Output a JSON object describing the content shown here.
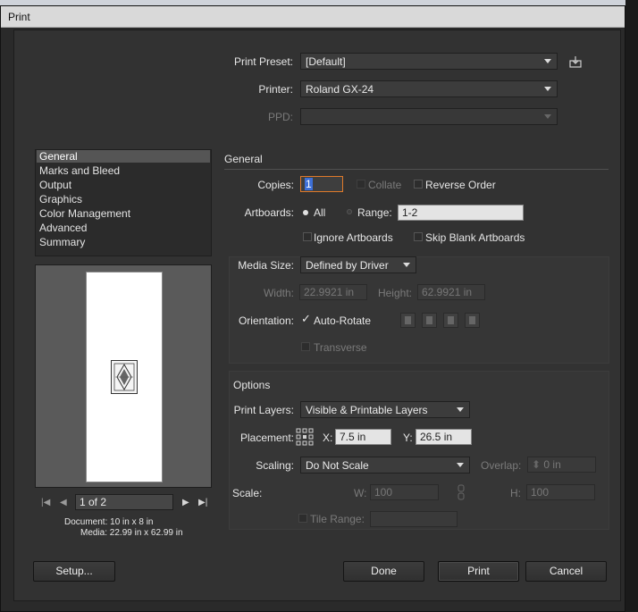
{
  "window": {
    "title": "Print"
  },
  "top": {
    "print_preset_label": "Print Preset:",
    "print_preset_value": "[Default]",
    "printer_label": "Printer:",
    "printer_value": "Roland GX-24",
    "ppd_label": "PPD:",
    "ppd_value": ""
  },
  "sidebar": {
    "items": [
      {
        "label": "General",
        "selected": true
      },
      {
        "label": "Marks and Bleed"
      },
      {
        "label": "Output"
      },
      {
        "label": "Graphics"
      },
      {
        "label": "Color Management"
      },
      {
        "label": "Advanced"
      },
      {
        "label": "Summary"
      }
    ],
    "page_indicator": "1 of 2",
    "document_info": "Document: 10 in x 8 in",
    "media_info": "Media: 22.99 in x 62.99 in"
  },
  "general": {
    "heading": "General",
    "copies_label": "Copies:",
    "copies_value": "1",
    "collate_label": "Collate",
    "reverse_order_label": "Reverse Order",
    "artboards_label": "Artboards:",
    "all_label": "All",
    "range_label": "Range:",
    "range_value": "1-2",
    "ignore_artboards_label": "Ignore Artboards",
    "skip_blank_label": "Skip Blank Artboards"
  },
  "media": {
    "size_label": "Media Size:",
    "size_value": "Defined by Driver",
    "width_label": "Width:",
    "width_value": "22.9921 in",
    "height_label": "Height:",
    "height_value": "62.9921 in",
    "orientation_label": "Orientation:",
    "auto_rotate_label": "Auto-Rotate",
    "auto_rotate_check": "✓",
    "transverse_label": "Transverse"
  },
  "options": {
    "heading": "Options",
    "print_layers_label": "Print Layers:",
    "print_layers_value": "Visible & Printable Layers",
    "placement_label": "Placement:",
    "x_label": "X:",
    "x_value": "7.5 in",
    "y_label": "Y:",
    "y_value": "26.5 in",
    "scaling_label": "Scaling:",
    "scaling_value": "Do Not Scale",
    "overlap_label": "Overlap:",
    "overlap_value": "0 in",
    "scale_label": "Scale:",
    "w_label": "W:",
    "w_value": "100",
    "h_label": "H:",
    "h_value": "100",
    "tile_range_label": "Tile Range:",
    "tile_range_value": ""
  },
  "buttons": {
    "setup": "Setup...",
    "done": "Done",
    "print": "Print",
    "cancel": "Cancel"
  },
  "colors": {
    "dialog_bg": "#323232",
    "panel_bg": "#2b2b2b",
    "selection": "#555555",
    "focus_ring": "#e07a2a"
  },
  "icons": {
    "save_preset": "save-preset-icon",
    "first_page": "first-page-icon",
    "prev_page": "prev-page-icon",
    "next_page": "next-page-icon",
    "last_page": "last-page-icon",
    "placement_grid": "placement-grid-icon",
    "link": "link-proportions-icon"
  }
}
